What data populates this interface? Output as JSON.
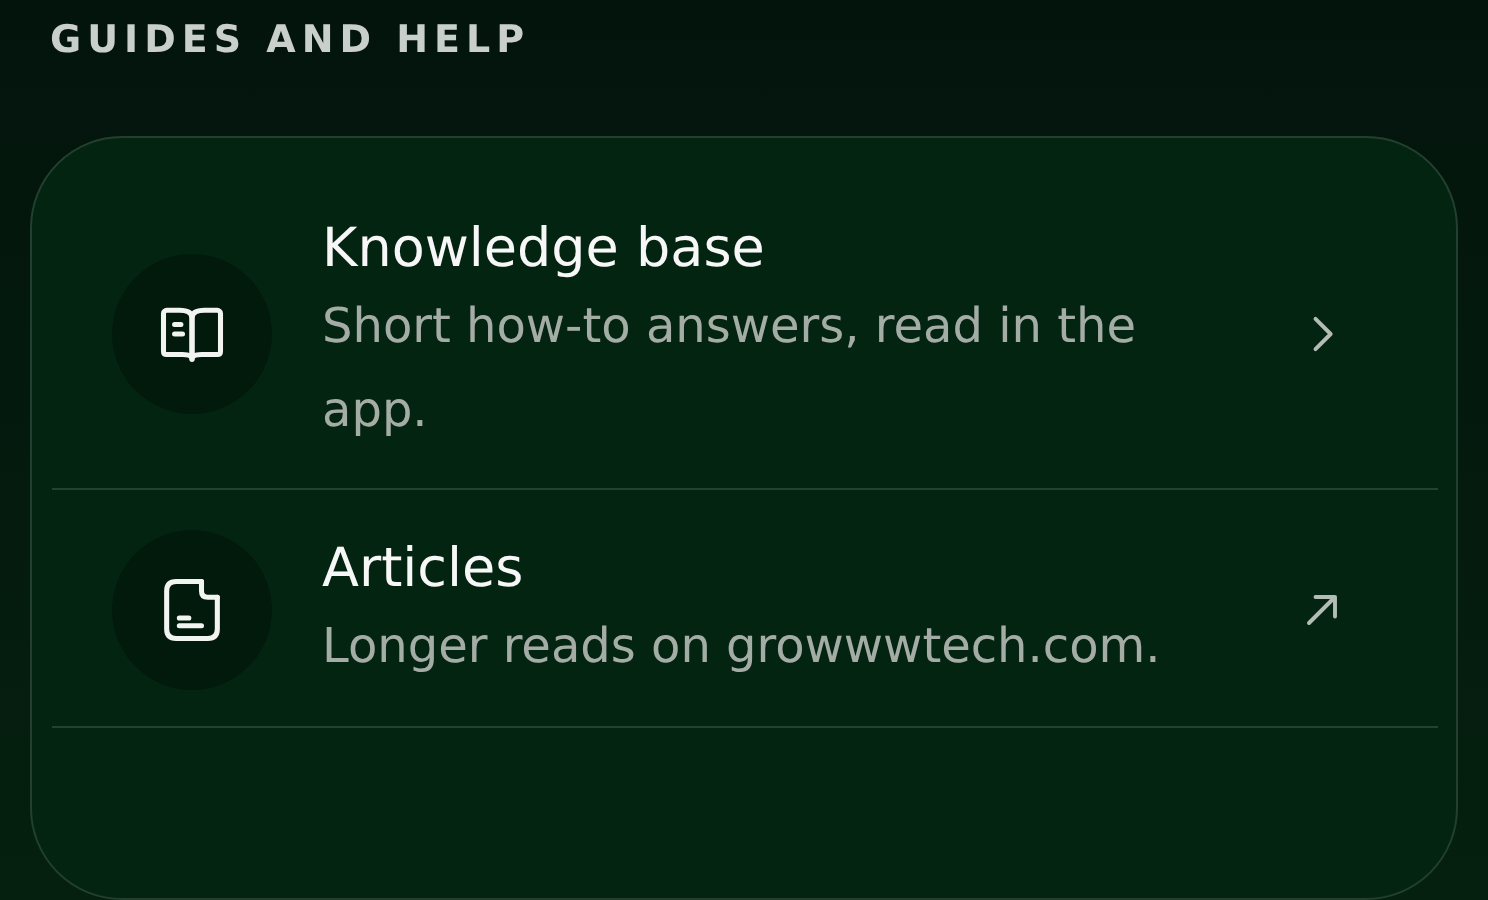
{
  "section_title": "GUIDES AND HELP",
  "items": [
    {
      "kind": "internal",
      "title": "Knowledge base",
      "description": "Short how-to answers, read in the app."
    },
    {
      "kind": "external",
      "title": "Articles",
      "description": "Longer reads on growwwtech.com."
    }
  ]
}
